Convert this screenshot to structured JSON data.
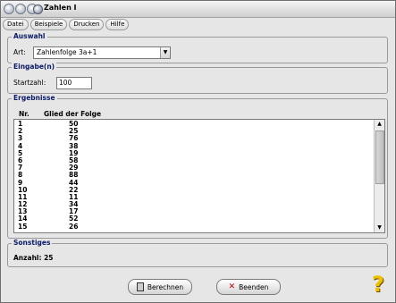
{
  "window": {
    "title": "Zahlen I"
  },
  "menu": [
    "Datei",
    "Beispiele",
    "Drucken",
    "Hilfe"
  ],
  "auswahl": {
    "title": "Auswahl",
    "label": "Art:",
    "value": "Zahlenfolge 3a+1"
  },
  "eingabe": {
    "title": "Eingabe(n)",
    "label": "Startzahl:",
    "value": "100"
  },
  "ergebnisse": {
    "title": "Ergebnisse",
    "col_nr": "Nr.",
    "col_val": "Glied der Folge",
    "rows": [
      [
        "1",
        "50"
      ],
      [
        "2",
        "25"
      ],
      [
        "3",
        "76"
      ],
      [
        "4",
        "38"
      ],
      [
        "5",
        "19"
      ],
      [
        "6",
        "58"
      ],
      [
        "7",
        "29"
      ],
      [
        "8",
        "88"
      ],
      [
        "9",
        "44"
      ],
      [
        "10",
        "22"
      ],
      [
        "11",
        "11"
      ],
      [
        "12",
        "34"
      ],
      [
        "13",
        "17"
      ],
      [
        "14",
        "52"
      ],
      [
        "15",
        "26"
      ]
    ]
  },
  "sonstiges": {
    "title": "Sonstiges",
    "text": "Anzahl: 25"
  },
  "buttons": {
    "calc": "Berechnen",
    "quit": "Beenden"
  },
  "icons": {
    "help": "help-icon"
  }
}
